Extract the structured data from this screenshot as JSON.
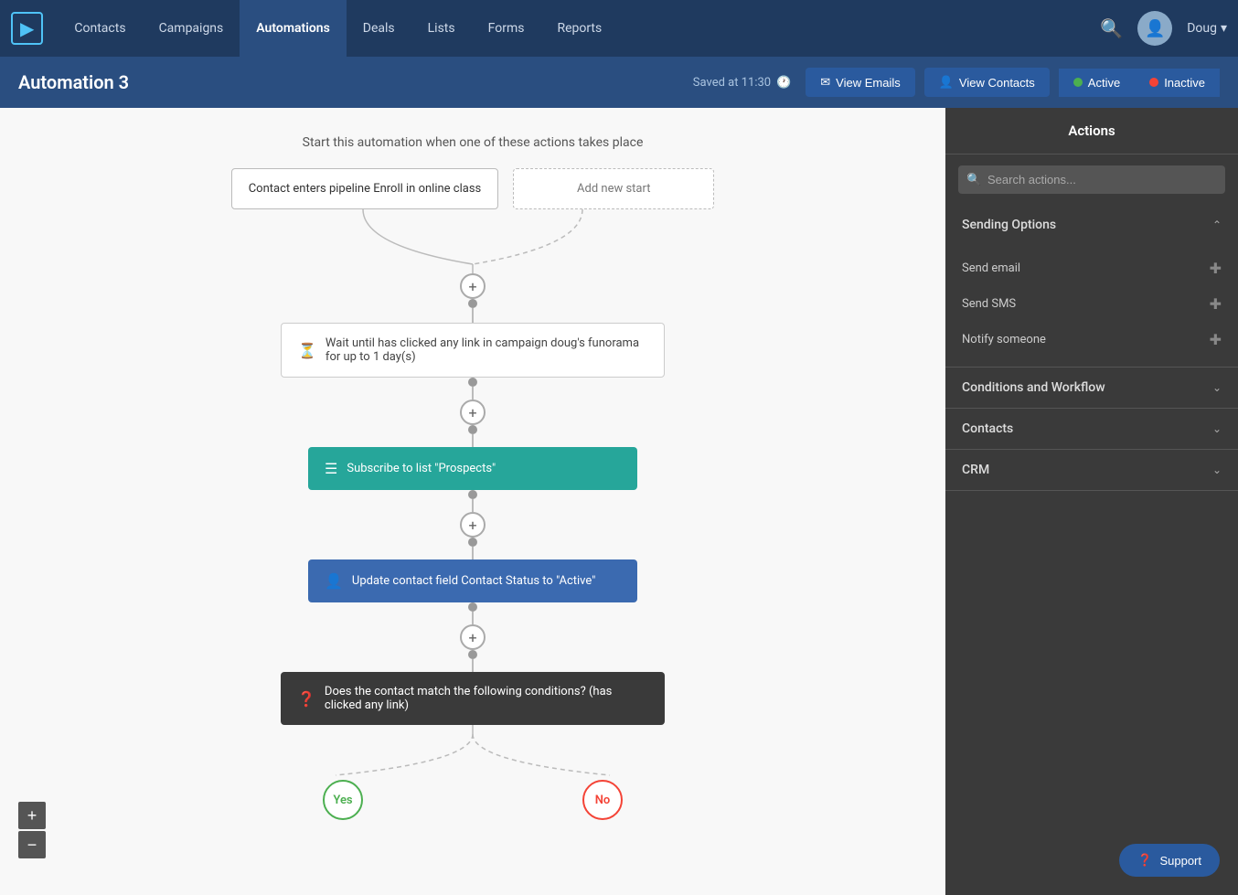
{
  "nav": {
    "toggle_icon": "▶",
    "links": [
      {
        "label": "Contacts",
        "active": false
      },
      {
        "label": "Campaigns",
        "active": false
      },
      {
        "label": "Automations",
        "active": true
      },
      {
        "label": "Deals",
        "active": false
      },
      {
        "label": "Lists",
        "active": false
      },
      {
        "label": "Forms",
        "active": false
      },
      {
        "label": "Reports",
        "active": false
      }
    ],
    "user_name": "Doug",
    "user_dropdown": "▾"
  },
  "sub_header": {
    "title": "Automation 3",
    "saved_text": "Saved at 11:30",
    "view_emails_label": "View Emails",
    "view_contacts_label": "View Contacts",
    "active_label": "Active",
    "inactive_label": "Inactive"
  },
  "canvas": {
    "instruction": "Start this automation when one of these actions takes place",
    "trigger1": "Contact enters pipeline Enroll in online class",
    "trigger2": "Add new start",
    "wait_node": "Wait until has clicked any link in campaign doug's funorama for up to 1 day(s)",
    "subscribe_node": "Subscribe to list \"Prospects\"",
    "update_node": "Update contact field Contact Status to \"Active\"",
    "condition_node": "Does the contact match the following conditions? (has clicked any link)",
    "yes_label": "Yes",
    "no_label": "No"
  },
  "right_panel": {
    "title": "Actions",
    "search_placeholder": "Search actions...",
    "sections": [
      {
        "label": "Sending Options",
        "expanded": true,
        "items": [
          {
            "label": "Send email"
          },
          {
            "label": "Send SMS"
          },
          {
            "label": "Notify someone"
          }
        ]
      },
      {
        "label": "Conditions and Workflow",
        "expanded": false,
        "items": []
      },
      {
        "label": "Contacts",
        "expanded": false,
        "items": []
      },
      {
        "label": "CRM",
        "expanded": false,
        "items": []
      }
    ],
    "support_label": "Support"
  },
  "zoom": {
    "plus": "+",
    "minus": "−"
  }
}
